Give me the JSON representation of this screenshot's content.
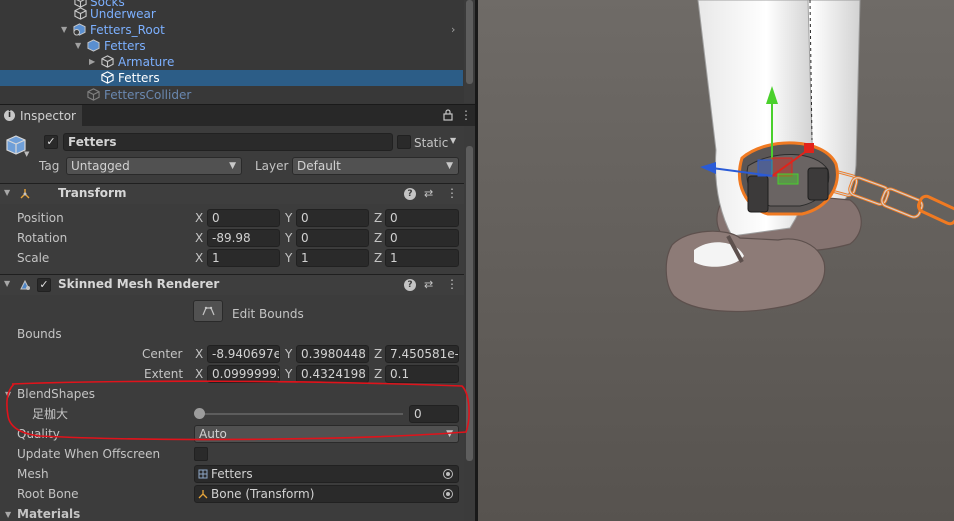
{
  "hierarchy": {
    "rows": [
      {
        "label": "Socks"
      },
      {
        "label": "Underwear"
      },
      {
        "label": "Fetters_Root"
      },
      {
        "label": "Fetters"
      },
      {
        "label": "Armature"
      },
      {
        "label": "Fetters"
      },
      {
        "label": "FettersCollider"
      }
    ]
  },
  "inspector": {
    "tab_label": "Inspector",
    "object": {
      "name": "Fetters",
      "active": true,
      "static_label": "Static",
      "tag_label": "Tag",
      "tag_value": "Untagged",
      "layer_label": "Layer",
      "layer_value": "Default"
    },
    "transform": {
      "title": "Transform",
      "rows": [
        {
          "label": "Position",
          "x": "0",
          "y": "0",
          "z": "0"
        },
        {
          "label": "Rotation",
          "x": "-89.98",
          "y": "0",
          "z": "0"
        },
        {
          "label": "Scale",
          "x": "1",
          "y": "1",
          "z": "1"
        }
      ]
    },
    "skinned_mesh_renderer": {
      "title": "Skinned Mesh Renderer",
      "enabled": true,
      "edit_bounds_label": "Edit Bounds",
      "bounds_label": "Bounds",
      "center_label": "Center",
      "center": {
        "x": "-8.940697e",
        "y": "0.3980448",
        "z": "7.450581e-"
      },
      "extent_label": "Extent",
      "extent": {
        "x": "0.09999993",
        "y": "0.4324198",
        "z": "0.1"
      },
      "blendshapes_label": "BlendShapes",
      "blendshape": {
        "name": "足枷大",
        "value": "0",
        "fraction": 0.0
      },
      "quality_label": "Quality",
      "quality_value": "Auto",
      "update_offscreen_label": "Update When Offscreen",
      "update_offscreen": false,
      "mesh_label": "Mesh",
      "mesh_value": "Fetters",
      "root_bone_label": "Root Bone",
      "root_bone_value": "Bone (Transform)",
      "materials_label": "Materials"
    },
    "axis_labels": {
      "x": "X",
      "y": "Y",
      "z": "Z"
    }
  },
  "colors": {
    "selection": "#2c5d87",
    "annotation": "#e0131b",
    "outline": "#f07a22",
    "gizmo_y": "#4ad02c",
    "gizmo_x": "#e2231a",
    "gizmo_z": "#2a5bd7"
  }
}
